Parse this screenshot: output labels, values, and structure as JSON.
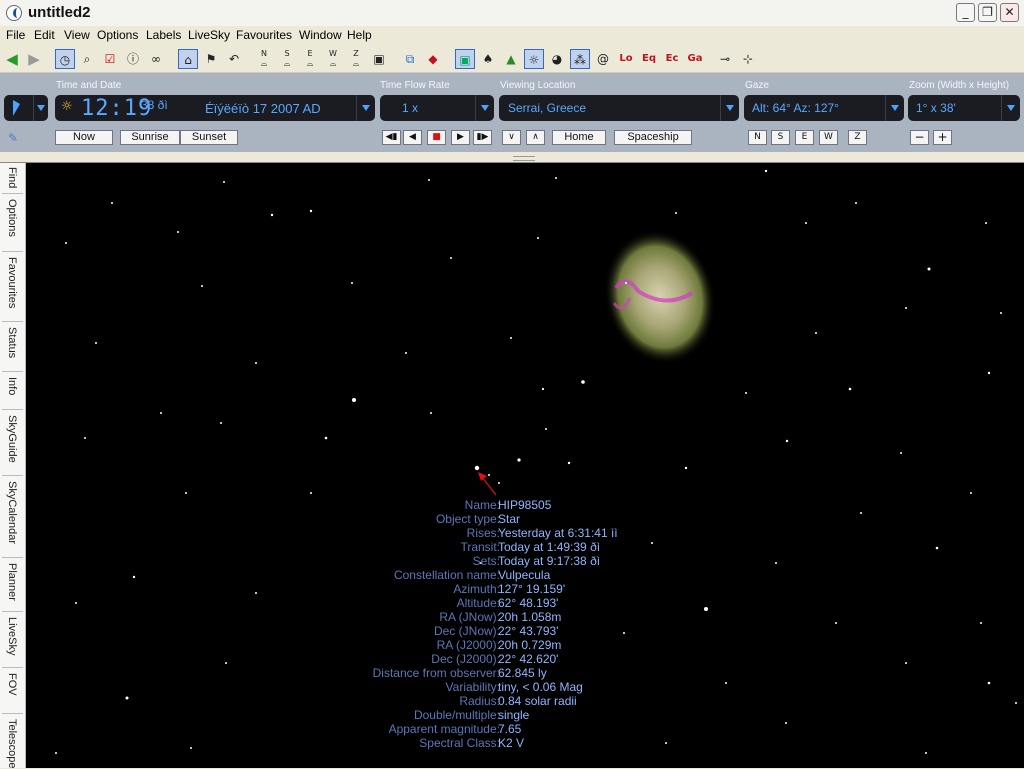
{
  "window": {
    "title": "untitled2",
    "buttons": {
      "minimize": "_",
      "maximize": "❐",
      "close": "✕"
    }
  },
  "menu": [
    "File",
    "Edit",
    "View",
    "Options",
    "Labels",
    "LiveSky",
    "Favourites",
    "Window",
    "Help"
  ],
  "toolbar": {
    "icons": [
      "back-icon",
      "forward-icon",
      "clock-icon",
      "magnifier-icon",
      "checklist-icon",
      "info-icon",
      "binoculars-icon",
      "home-icon",
      "flag-icon",
      "undo-icon",
      "north-icon",
      "south-icon",
      "east-icon",
      "west-icon",
      "zenith-icon",
      "field-icon",
      "panel-icon",
      "diamond-icon",
      "photo-icon",
      "tree-icon",
      "landscape-icon",
      "sun-icon",
      "planet-icon",
      "constellation-icon",
      "spiral-icon"
    ],
    "grid_labels": [
      "Lo",
      "Eq",
      "Ec",
      "Ga"
    ],
    "compass_labels": [
      "N",
      "S",
      "E",
      "W",
      "Z"
    ]
  },
  "panel": {
    "time_date_label": "Time and Date",
    "time": "12:19",
    "seconds": "38 ðì",
    "date": "Éïýëéïò 17   2007 AD",
    "flow_label": "Time Flow Rate",
    "flow_value": "1 x",
    "location_label": "Viewing Location",
    "location_value": "Serrai, Greece",
    "gaze_label": "Gaze",
    "gaze_value": "Alt: 64° Az: 127°",
    "zoom_label": "Zoom (Width x Height)",
    "zoom_value": "1° x 38'",
    "buttons": {
      "now": "Now",
      "sunrise": "Sunrise",
      "sunset": "Sunset",
      "home": "Home",
      "spaceship": "Spaceship",
      "n": "N",
      "s": "S",
      "e": "E",
      "w": "W",
      "z": "Z",
      "zoom_out": "−",
      "zoom_in": "+",
      "flow_back_fast": "◀▮",
      "flow_back": "◀",
      "flow_stop": "■",
      "flow_fwd": "▶",
      "flow_fwd_fast": "▮▶",
      "chevron_down": "∨",
      "chevron_up": "∧"
    }
  },
  "sidetabs": [
    "Find",
    "Options",
    "Favourites",
    "Status",
    "Info",
    "SkyGuide",
    "SkyCalendar",
    "Planner",
    "LiveSky",
    "FOV",
    "Telescope"
  ],
  "info": [
    {
      "label": "Name:",
      "value": "HIP98505"
    },
    {
      "label": "Object type:",
      "value": "Star"
    },
    {
      "label": "Rises:",
      "value": "Yesterday at 6:31:41 ìì"
    },
    {
      "label": "Transit:",
      "value": "Today at 1:49:39 ðì"
    },
    {
      "label": "Sets:",
      "value": "Today at 9:17:38 ðì"
    },
    {
      "label": "Constellation name:",
      "value": "Vulpecula"
    },
    {
      "label": "Azimuth:",
      "value": "127° 19.159'"
    },
    {
      "label": "Altitude:",
      "value": "62° 48.193'"
    },
    {
      "label": "RA (JNow):",
      "value": "20h 1.058m"
    },
    {
      "label": "Dec (JNow):",
      "value": "22° 43.793'"
    },
    {
      "label": "RA (J2000):",
      "value": "20h 0.729m"
    },
    {
      "label": "Dec (J2000):",
      "value": "22° 42.620'"
    },
    {
      "label": "Distance from observer:",
      "value": "62.845 ly"
    },
    {
      "label": "Variability:",
      "value": "tiny, < 0.06 Mag"
    },
    {
      "label": "Radius:",
      "value": "0.84 solar radii"
    },
    {
      "label": "Double/multiple:",
      "value": "single"
    },
    {
      "label": "Apparent magnitude:",
      "value": "7.65"
    },
    {
      "label": "Spectral Class:",
      "value": "K2 V"
    }
  ],
  "colors": {
    "sky": "#000000",
    "info_label": "#5a78b8",
    "info_value": "#8fb5ff",
    "panel_bg": "#aab4c1",
    "pointer": "#e01010"
  }
}
